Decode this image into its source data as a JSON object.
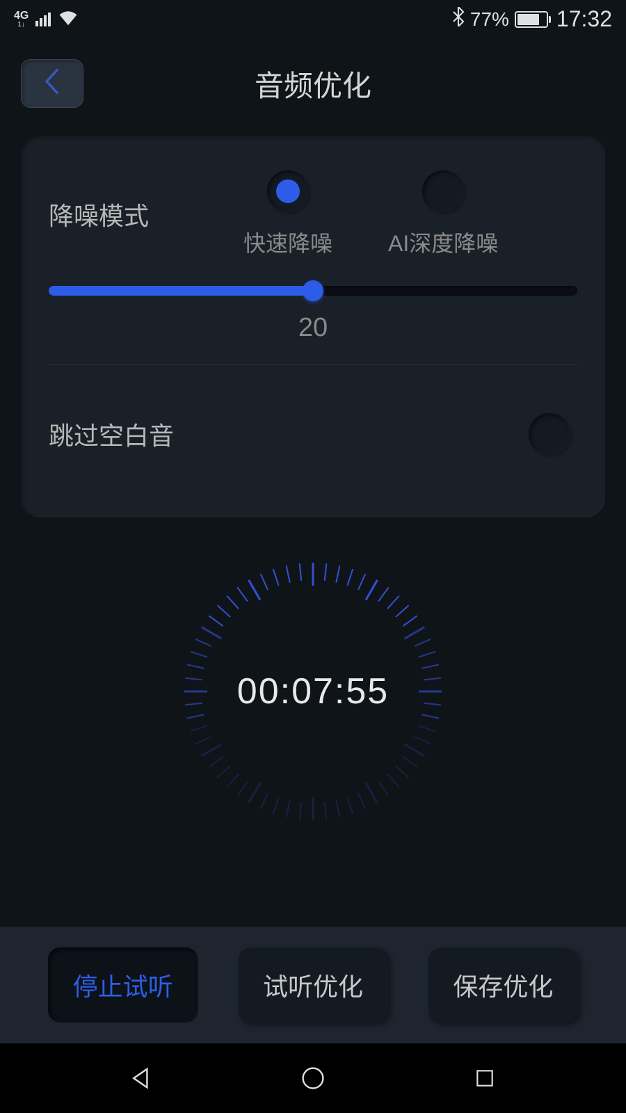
{
  "statusBar": {
    "networkType": "4G",
    "batteryPercent": "77%",
    "time": "17:32"
  },
  "header": {
    "title": "音频优化"
  },
  "panel": {
    "noiseReduction": {
      "label": "降噪模式",
      "option1": "快速降噪",
      "option2": "AI深度降噪",
      "selected": 0
    },
    "slider": {
      "value": "20",
      "percent": 50
    },
    "skipSilence": {
      "label": "跳过空白音",
      "enabled": false
    }
  },
  "timer": {
    "display": "00:07:55"
  },
  "buttons": {
    "stopPreview": "停止试听",
    "previewOptimize": "试听优化",
    "saveOptimize": "保存优化"
  }
}
